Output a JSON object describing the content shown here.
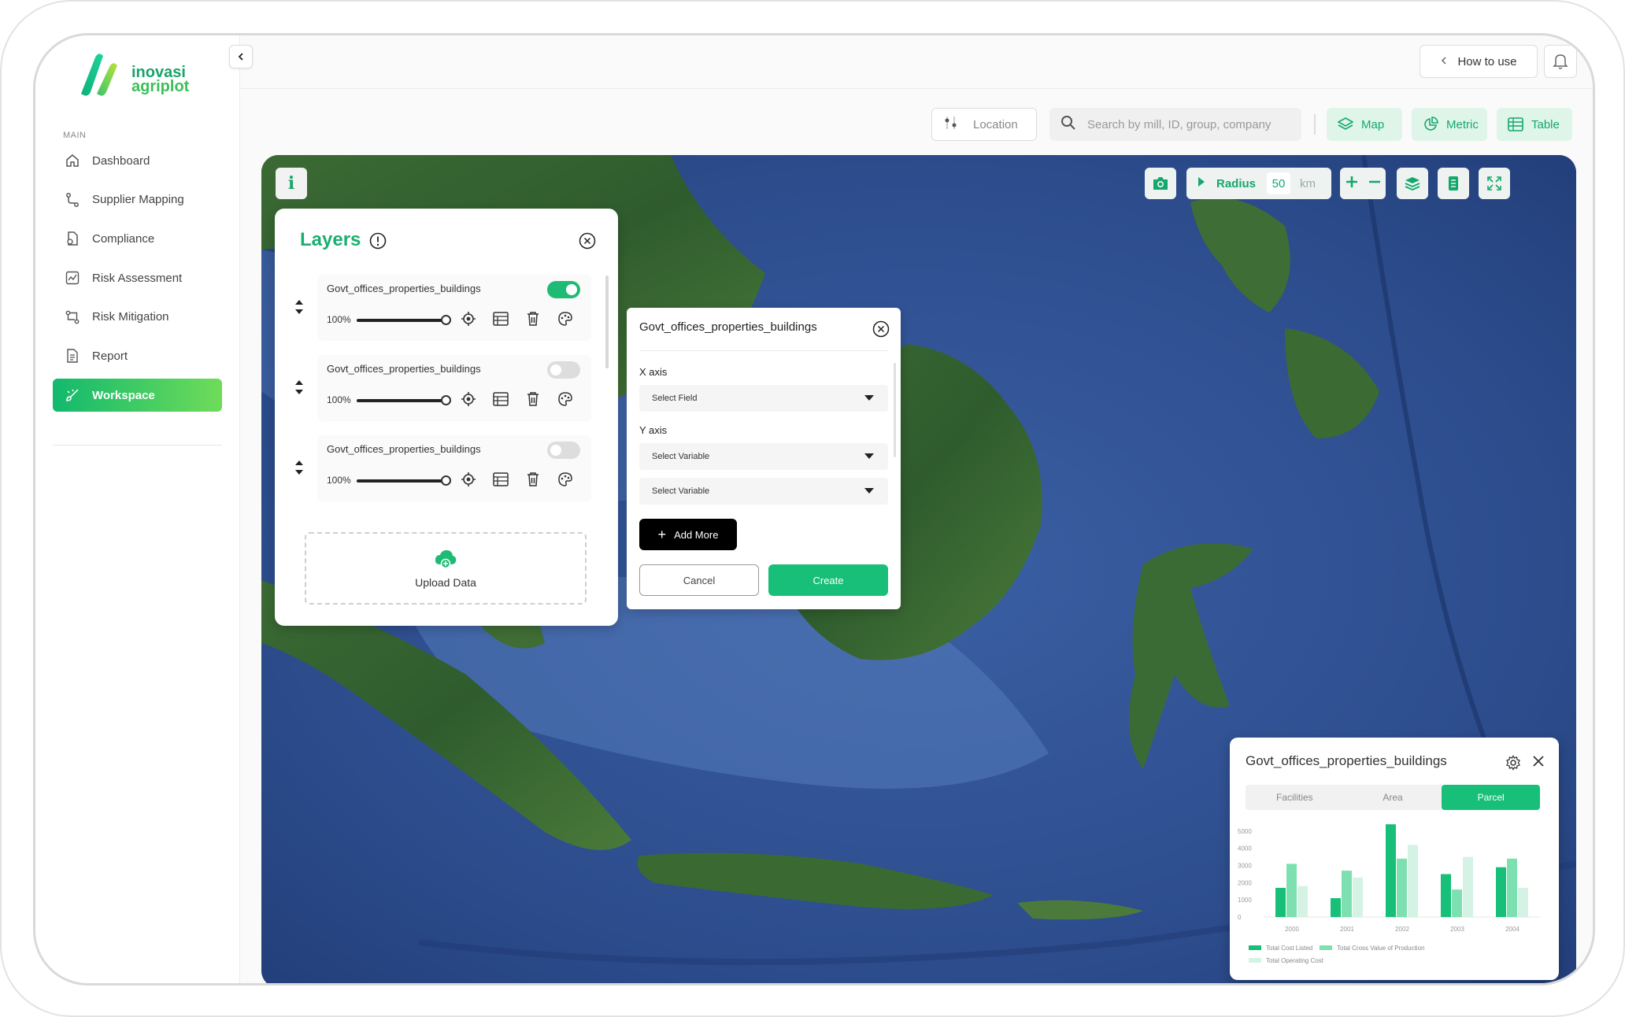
{
  "app": {
    "brand_line1": "inovasi",
    "brand_line2": "agriplot"
  },
  "sidebar": {
    "section_label": "MAIN",
    "items": [
      {
        "label": "Dashboard",
        "icon": "home-icon"
      },
      {
        "label": "Supplier Mapping",
        "icon": "route-icon"
      },
      {
        "label": "Compliance",
        "icon": "document-check-icon"
      },
      {
        "label": "Risk Assessment",
        "icon": "chart-line-icon"
      },
      {
        "label": "Risk Mitigation",
        "icon": "flow-icon"
      },
      {
        "label": "Report",
        "icon": "report-icon"
      },
      {
        "label": "Workspace",
        "icon": "brush-icon",
        "active": true
      }
    ]
  },
  "header": {
    "how_to_use": "How to use",
    "location_label": "Location",
    "search_placeholder": "Search by mill, ID, group, company",
    "views": [
      "Map",
      "Metric",
      "Table"
    ]
  },
  "map_toolbar": {
    "info": "i",
    "radius_label": "Radius",
    "radius_value": "50",
    "radius_unit": "km"
  },
  "layers_panel": {
    "title": "Layers",
    "layers": [
      {
        "name": "Govt_offices_properties_buildings",
        "opacity": "100%",
        "visible": true
      },
      {
        "name": "Govt_offices_properties_buildings",
        "opacity": "100%",
        "visible": false
      },
      {
        "name": "Govt_offices_properties_buildings",
        "opacity": "100%",
        "visible": false
      }
    ],
    "upload_label": "Upload Data"
  },
  "chart_dialog": {
    "title": "Govt_offices_properties_buildings",
    "x_axis_label": "X axis",
    "x_field": "Select Field",
    "y_axis_label": "Y axis",
    "y_vars": [
      "Select Variable",
      "Select Variable"
    ],
    "add_more": "Add More",
    "cancel": "Cancel",
    "create": "Create"
  },
  "chart_card": {
    "title": "Govt_offices_properties_buildings",
    "tabs": [
      "Facilities",
      "Area",
      "Parcel"
    ],
    "active_tab": "Parcel"
  },
  "colors": {
    "accent": "#17bf78",
    "series1": "#17bf78",
    "series2": "#7de0b0",
    "series3": "#d4f3e4"
  },
  "chart_data": {
    "type": "bar",
    "categories": [
      "2000",
      "2001",
      "2002",
      "2003",
      "2004"
    ],
    "series": [
      {
        "name": "Total Cost Listed",
        "values": [
          1700,
          1100,
          5400,
          2500,
          2900
        ]
      },
      {
        "name": "Total Cross Value of Production",
        "values": [
          3100,
          2700,
          3400,
          1600,
          3400
        ]
      },
      {
        "name": "Total Operating Cost",
        "values": [
          1800,
          2300,
          4200,
          3500,
          1700
        ]
      }
    ],
    "yticks": [
      "5000",
      "4000",
      "3000",
      "2000",
      "1000",
      "0"
    ],
    "ylim": [
      0,
      5500
    ],
    "title": "",
    "xlabel": "",
    "ylabel": "",
    "legend": "bottom-left"
  }
}
